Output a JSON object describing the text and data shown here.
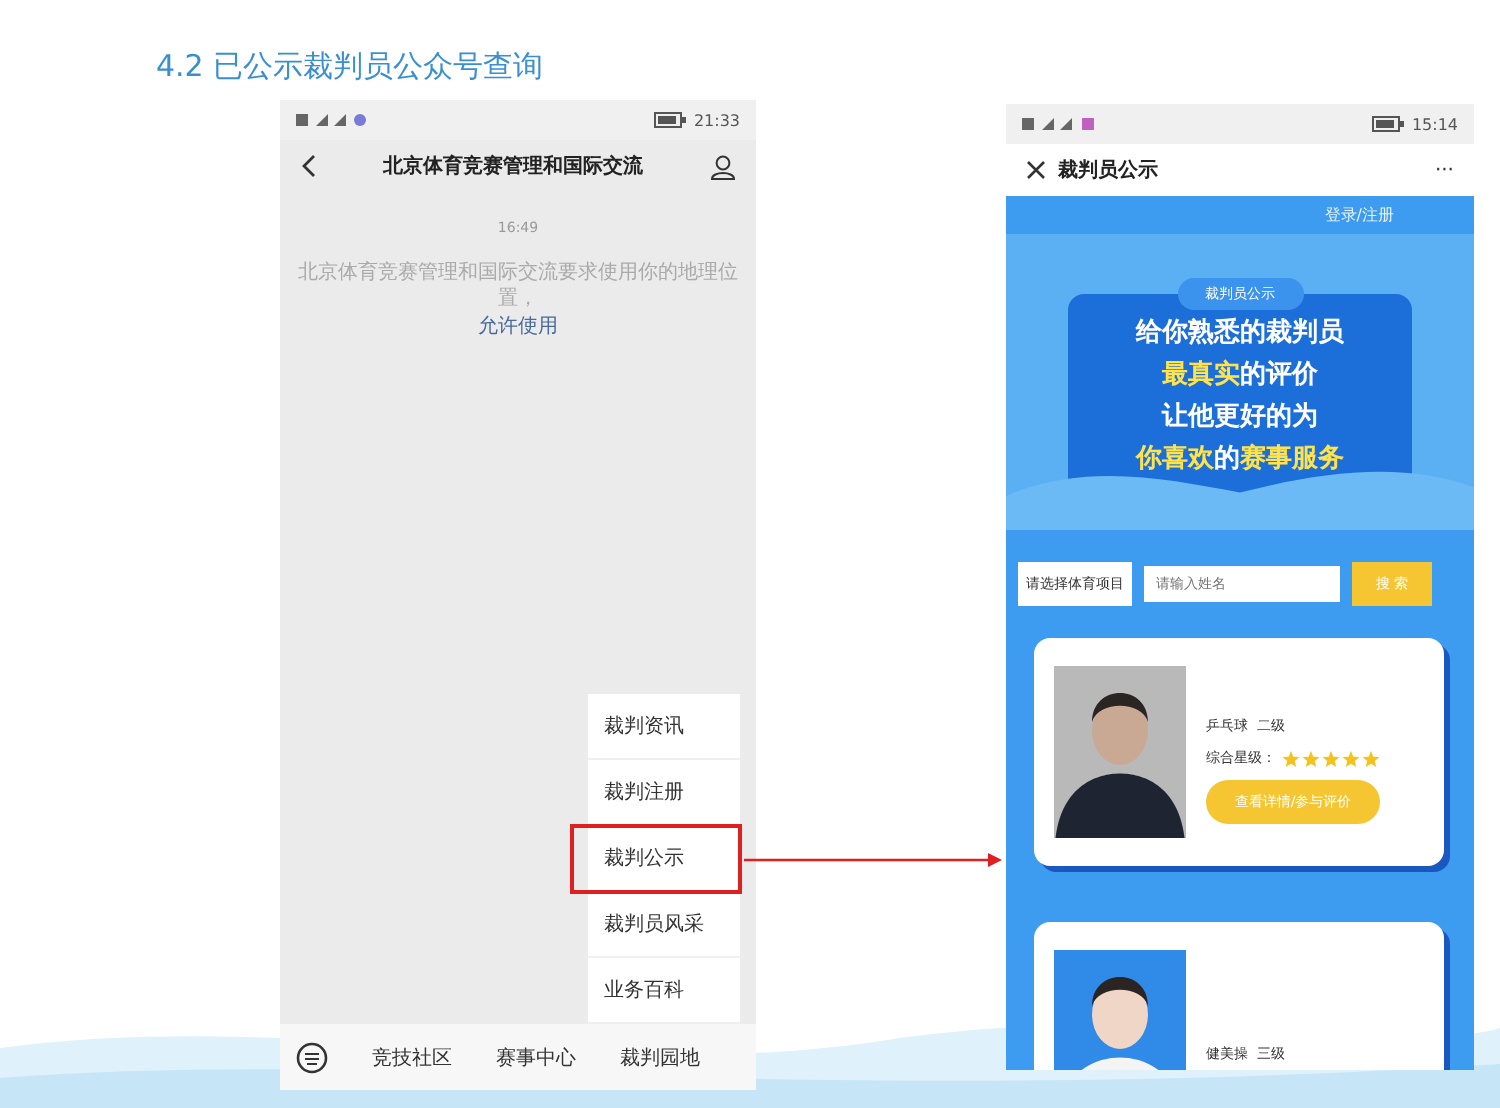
{
  "title": "4.2 已公示裁判员公众号查询",
  "left_phone": {
    "status_time": "21:33",
    "nav_title": "北京体育竞赛管理和国际交流",
    "message_time": "16:49",
    "message": "北京体育竞赛管理和国际交流要求使用你的地理位置，",
    "message_link": "允许使用",
    "menu": [
      {
        "label": "裁判资讯",
        "selected": false
      },
      {
        "label": "裁判注册",
        "selected": false
      },
      {
        "label": "裁判公示",
        "selected": true
      },
      {
        "label": "裁判员风采",
        "selected": false
      },
      {
        "label": "业务百科",
        "selected": false
      }
    ],
    "bottom_tabs": [
      "竞技社区",
      "赛事中心",
      "裁判园地"
    ]
  },
  "right_phone": {
    "status_time": "15:14",
    "nav_title": "裁判员公示",
    "nav_more": "···",
    "login": "登录/注册",
    "banner": {
      "tag": "裁判员公示",
      "lines": [
        [
          {
            "text": "给你熟悉的裁判员",
            "highlight": false
          }
        ],
        [
          {
            "text": "最真实",
            "highlight": true
          },
          {
            "text": "的评价",
            "highlight": false
          }
        ],
        [
          {
            "text": "让他更好的为",
            "highlight": false
          }
        ],
        [
          {
            "text": "你喜欢",
            "highlight": true
          },
          {
            "text": "的",
            "highlight": false
          },
          {
            "text": "赛事服务",
            "highlight": true
          }
        ]
      ]
    },
    "select": "请选择体育项目",
    "name_placeholder": "请输入姓名",
    "search_button": "搜 索",
    "cards": [
      {
        "sport": "乒乓球  二级",
        "rating_label": "综合星级：",
        "stars": 5,
        "button": "查看详情/参与评价"
      },
      {
        "sport": "健美操  三级"
      }
    ]
  }
}
